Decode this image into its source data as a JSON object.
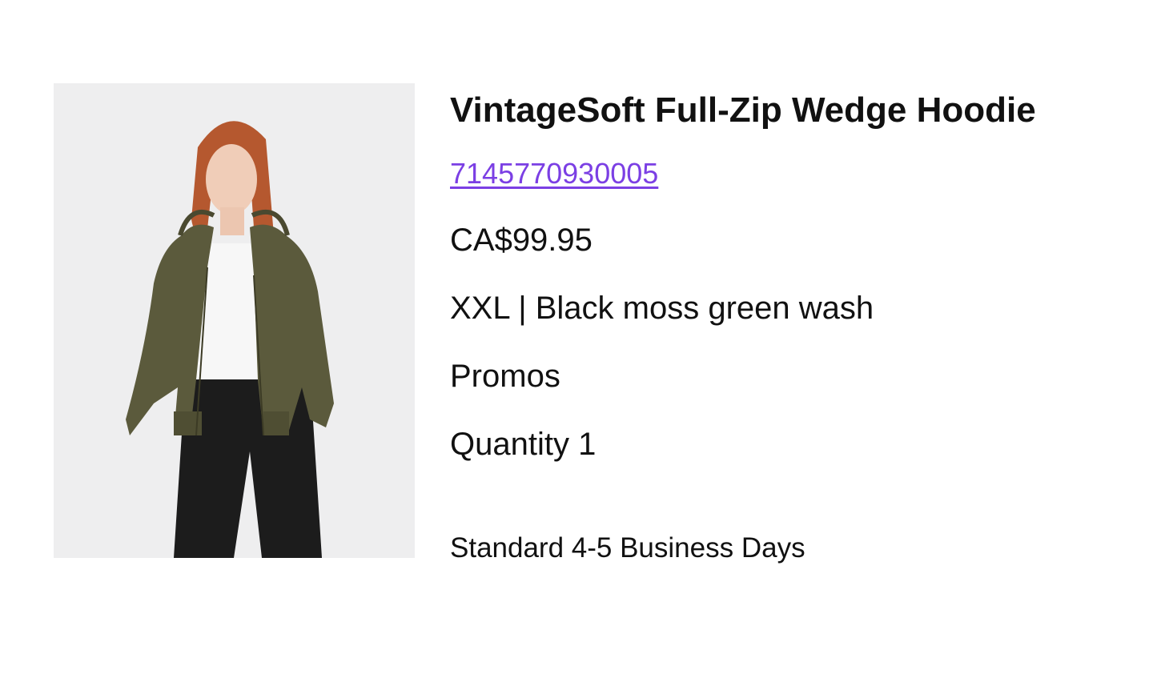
{
  "product": {
    "title": "VintageSoft Full-Zip Wedge Hoodie",
    "sku": "7145770930005",
    "price": "CA$99.95",
    "variant": "XXL | Black moss green wash",
    "promos_label": "Promos",
    "quantity_label": "Quantity 1",
    "shipping": "Standard 4-5 Business Days",
    "image_icon": "product-photo-hoodie-model"
  },
  "colors": {
    "link": "#7b3fe4",
    "image_background": "#eeeeef",
    "hoodie": "#5b5a3c"
  }
}
